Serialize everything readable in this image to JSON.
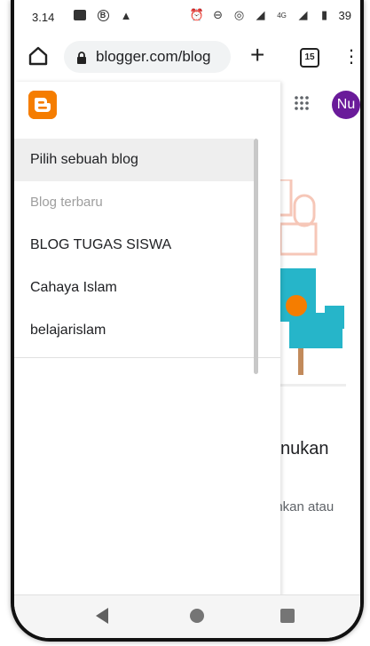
{
  "status_bar": {
    "time": "3.14",
    "network_label": "4G",
    "battery": "39"
  },
  "browser": {
    "url": "blogger.com/blog",
    "tab_count": "15",
    "plus_label": "+",
    "menu_label": "⋮"
  },
  "page": {
    "avatar_initials": "Nu",
    "heading_partial": "nukan",
    "sub_partial": "ahkan atau"
  },
  "drawer": {
    "items": [
      {
        "label": "Pilih sebuah blog"
      },
      {
        "label": "Blog terbaru"
      },
      {
        "label": "BLOG TUGAS SISWA"
      },
      {
        "label": "Cahaya Islam"
      },
      {
        "label": "belajarislam"
      }
    ]
  },
  "colors": {
    "blogger_orange": "#f57d00",
    "avatar_purple": "#6a1b9a",
    "illustration_teal": "#26b5c9"
  },
  "icons": [
    "home-icon",
    "lock-icon",
    "tabs-icon",
    "apps-grid-icon",
    "blogger-logo-icon",
    "back-icon",
    "home-circle-icon",
    "recents-icon"
  ]
}
